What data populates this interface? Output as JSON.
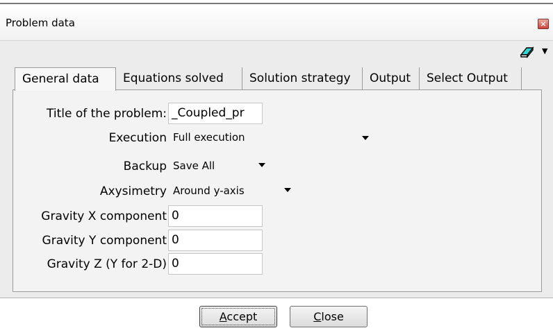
{
  "window": {
    "title": "Problem data",
    "close_glyph": "×"
  },
  "toolbar": {
    "icon": "eraser-icon",
    "menu_arrow": "▼"
  },
  "tabs": [
    {
      "label": "General data",
      "active": true
    },
    {
      "label": "Equations solved",
      "active": false
    },
    {
      "label": "Solution strategy",
      "active": false
    },
    {
      "label": "Output",
      "active": false
    },
    {
      "label": "Select Output",
      "active": false
    }
  ],
  "form": {
    "title_label": "Title of the problem:",
    "title_value": "_Coupled_pr",
    "execution_label": "Execution",
    "execution_value": "Full execution",
    "backup_label": "Backup",
    "backup_value": "Save All",
    "axysimetry_label": "Axysimetry",
    "axysimetry_value": "Around y-axis",
    "gravity_x_label": "Gravity X component",
    "gravity_x_value": "0",
    "gravity_y_label": "Gravity Y component",
    "gravity_y_value": "0",
    "gravity_z_label": "Gravity Z (Y for 2-D)",
    "gravity_z_value": "0"
  },
  "buttons": {
    "accept_first": "A",
    "accept_rest": "ccept",
    "close_first": "C",
    "close_rest": "lose"
  }
}
